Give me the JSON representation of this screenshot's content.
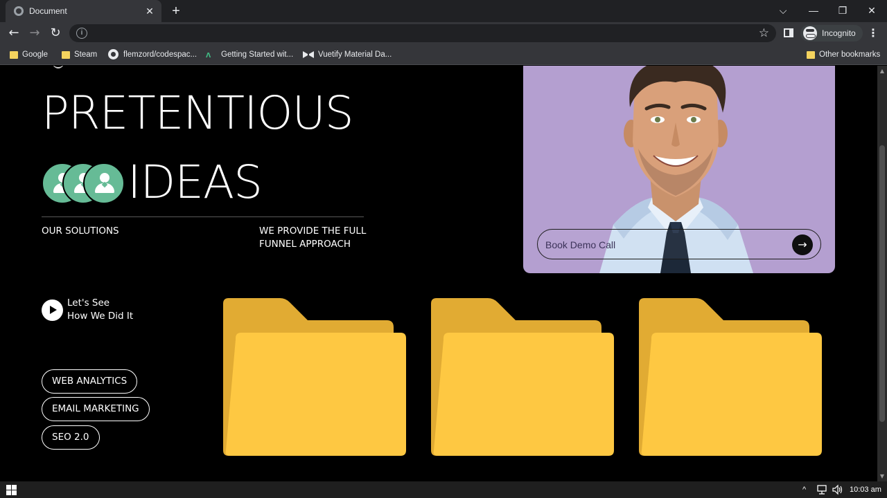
{
  "browser": {
    "tab_title": "Document",
    "tab_close": "✕",
    "new_tab": "+",
    "window_controls": {
      "dropdown": "⌵",
      "minimize": "—",
      "restore": "❐",
      "close": "✕"
    },
    "nav": {
      "back": "←",
      "forward": "→",
      "reload": "↻"
    },
    "address_icon": "i",
    "star": "☆",
    "incognito_label": "Incognito",
    "menu": "⋮",
    "bookmarks": [
      {
        "label": "Google",
        "icon": "folder-icon"
      },
      {
        "label": "Steam",
        "icon": "folder-icon"
      },
      {
        "label": "flemzord/codespac...",
        "icon": "github-icon"
      },
      {
        "label": "Getting Started wit...",
        "icon": "vue-icon"
      },
      {
        "label": "Vuetify Material Da...",
        "icon": "bow-icon"
      }
    ],
    "other_bookmarks": "Other bookmarks"
  },
  "page": {
    "headline_line1": "PRETENTIOUS",
    "headline_line2": "IDEAS",
    "our_solutions": "OUR SOLUTIONS",
    "funnel_text": "WE PROVIDE THE FULL FUNNEL APPROACH",
    "hero": {
      "placeholder": "Book Demo Call",
      "button_icon": "→",
      "accent": "#b49fd0"
    },
    "play": {
      "line1": "Let's See",
      "line2": "How We Did It"
    },
    "services": [
      "WEB ANALYTICS",
      "EMAIL MARKETING",
      "SEO 2.0"
    ],
    "folder_color": "#fec842",
    "folder_back_color": "#e1ab33"
  },
  "taskbar": {
    "time": "10:03 am",
    "tray_chevron": "^"
  }
}
